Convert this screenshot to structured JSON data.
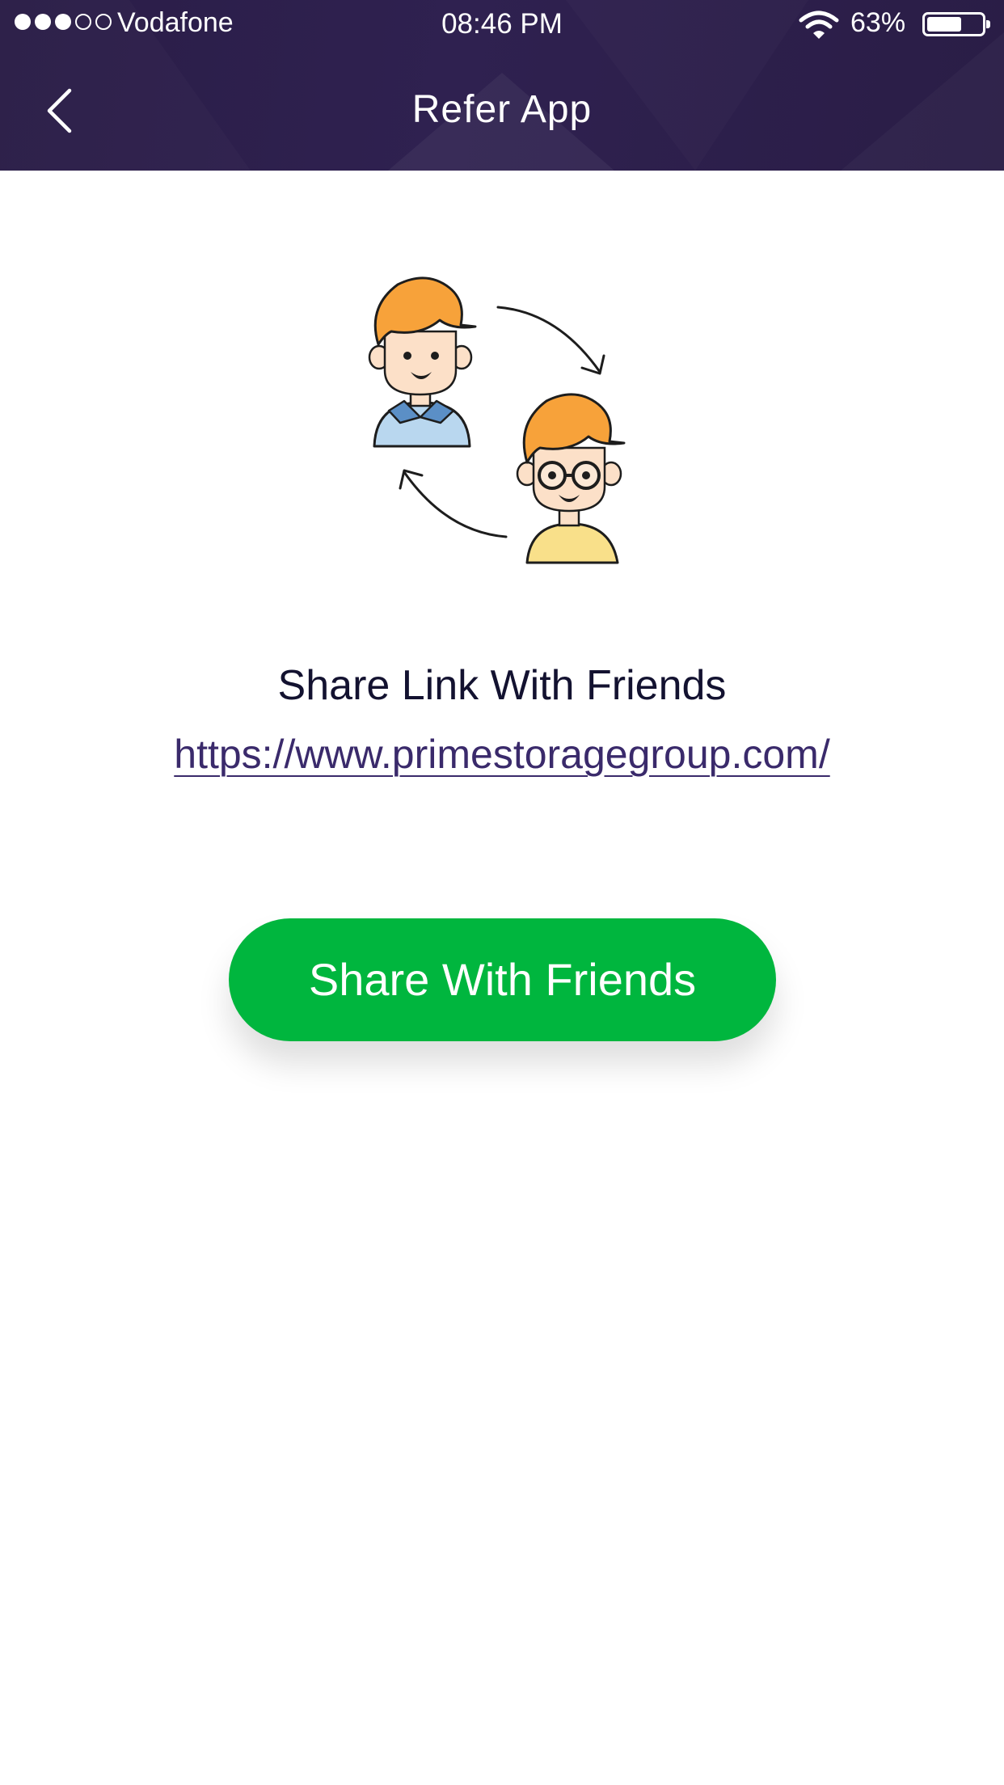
{
  "status_bar": {
    "carrier": "Vodafone",
    "signal_bars_filled": 3,
    "signal_bars_total": 5,
    "time": "08:46 PM",
    "battery_percent": "63%",
    "battery_level": 0.63,
    "icons": [
      "signal-dots-icon",
      "wifi-icon",
      "battery-icon"
    ]
  },
  "header": {
    "title": "Refer App",
    "back_icon": "chevron-left-icon",
    "background_color": "#2d1f4c"
  },
  "main": {
    "illustration_icon": "refer-friends-illustration",
    "heading": "Share Link With Friends",
    "link": "https://www.primestoragegroup.com/",
    "link_color": "#3a2a6b"
  },
  "actions": {
    "share_button_label": "Share With Friends",
    "share_button_color": "#00b63e"
  }
}
